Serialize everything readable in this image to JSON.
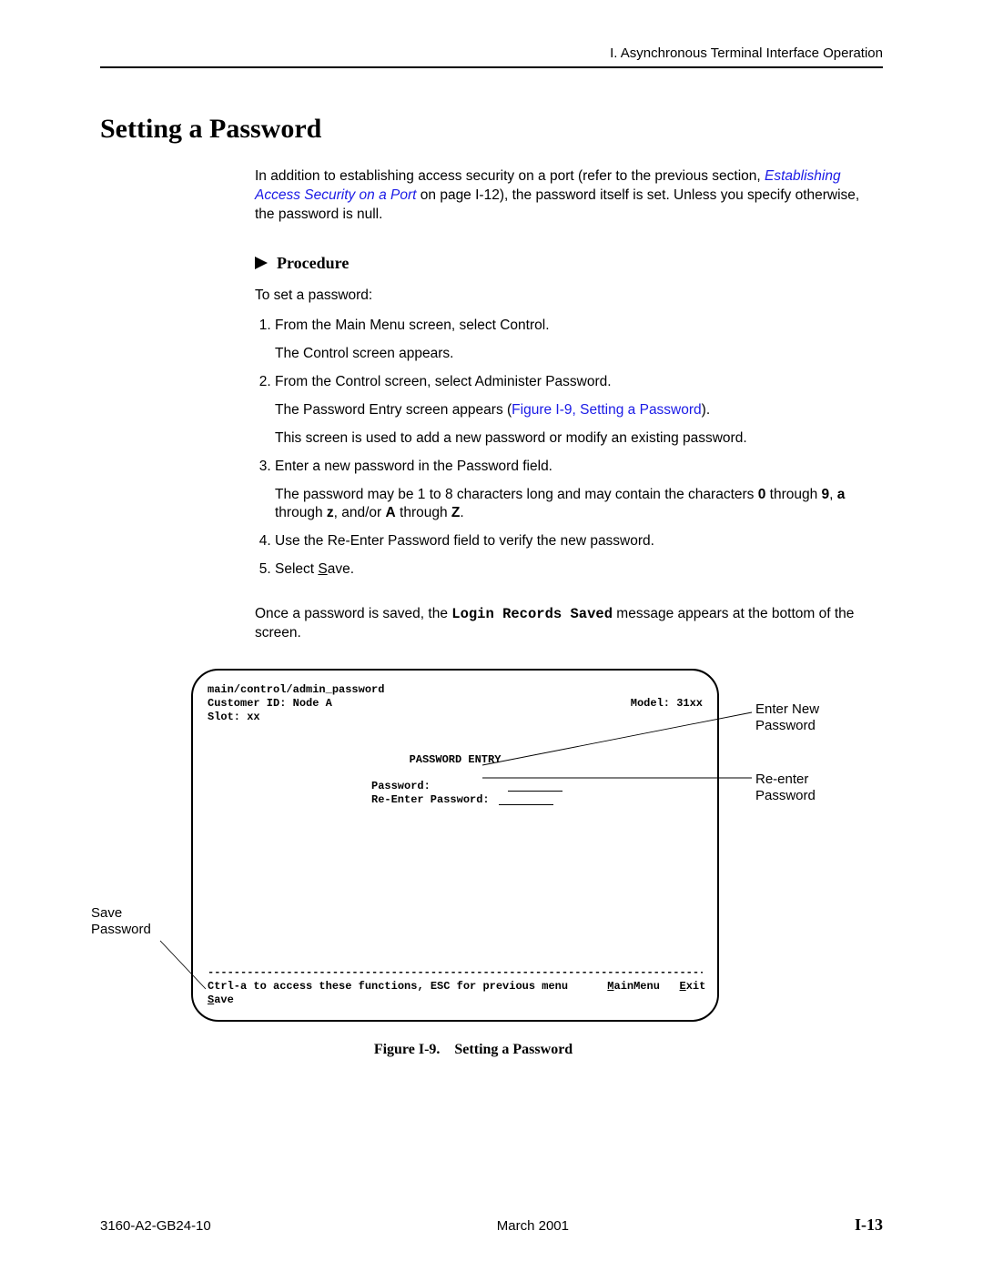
{
  "header": {
    "running": "I. Asynchronous Terminal Interface Operation"
  },
  "title": "Setting a Password",
  "intro": {
    "pre": "In addition to establishing access security on a port (refer to the previous section, ",
    "link": "Establishing Access Security on a Port",
    "mid": " on page I-12), the password itself is set. Unless you specify otherwise, the password is null."
  },
  "procedure_label": "Procedure",
  "lead": "To set a password:",
  "steps": {
    "s1": "From the Main Menu screen, select Control.",
    "s1b": "The Control screen appears.",
    "s2": "From the Control screen, select Administer Password.",
    "s2b_pre": "The Password Entry screen appears (",
    "s2b_link": "Figure I-9, Setting a Password",
    "s2b_post": ").",
    "s2c": "This screen is used to add a new password or modify an existing password.",
    "s3": "Enter a new password in the Password field.",
    "s3b_a": "The password may be 1 to 8 characters long and may contain the characters ",
    "s3b_b": "0",
    "s3b_c": " through ",
    "s3b_d": "9",
    "s3b_e": ", ",
    "s3b_f": "a",
    "s3b_g": " through ",
    "s3b_h": "z",
    "s3b_i": ", and/or ",
    "s3b_j": "A",
    "s3b_k": " through ",
    "s3b_l": "Z",
    "s3b_m": ".",
    "s4": "Use the Re-Enter Password field to verify the new password.",
    "s5_a": "Select ",
    "s5_b": "S",
    "s5_c": "ave."
  },
  "after": {
    "a": "Once a password is saved, the ",
    "b": "Login Records Saved",
    "c": " message appears at the bottom of the screen."
  },
  "terminal": {
    "path": "main/control/admin_password",
    "cust": "Customer ID: Node A",
    "model": "Model: 31xx",
    "slot": "Slot:  xx",
    "title": "PASSWORD ENTRY",
    "pw_label": "Password:",
    "re_label": "Re-Enter Password:",
    "dashes": "-----------------------------------------------------------------------------------",
    "help": "Ctrl-a to access these functions, ESC for previous menu",
    "menu_m": "M",
    "menu_main": "ainMenu",
    "menu_e": "E",
    "menu_exit": "xit",
    "save_s": "S",
    "save_ave": "ave"
  },
  "callouts": {
    "enter": "Enter New Password",
    "reenter": "Re-enter Password",
    "save": "Save Password"
  },
  "figure_caption": {
    "num": "Figure I-9.",
    "title": "Setting a Password"
  },
  "footer": {
    "doc": "3160-A2-GB24-10",
    "date": "March 2001",
    "page": "I-13"
  }
}
